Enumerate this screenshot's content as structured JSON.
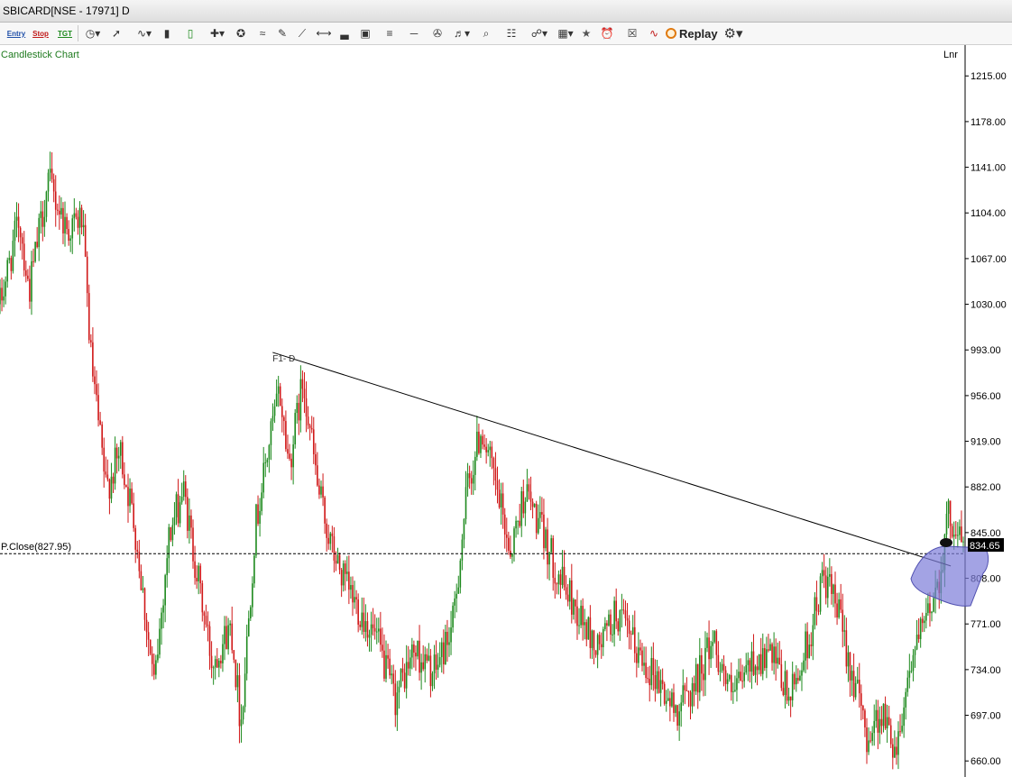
{
  "window": {
    "title": "SBICARD[NSE - 17971] D"
  },
  "toolbar": {
    "entry_label": "Entry",
    "stop_label": "Stop",
    "target_label": "TGT",
    "replay_label": "Replay",
    "icons": [
      "clock-icon",
      "cursor-icon",
      "indicator-icon",
      "bar-chart-icon",
      "candle-icon",
      "crosshair-icon",
      "magnet-icon",
      "wave-icon",
      "ruler-icon",
      "trendline-icon",
      "horizontal-ray-icon",
      "volume-icon",
      "cube-icon",
      "fibonacci-icon",
      "hline-icon",
      "measure-icon",
      "paint-icon",
      "zoom-icon",
      "report-icon",
      "link-icon",
      "layout-icon",
      "star-icon",
      "alert-icon",
      "delete-icon",
      "compare-icon",
      "gear-icon"
    ]
  },
  "chart_header": {
    "label": "Candlestick Chart",
    "scale_label": "Lnr"
  },
  "chart_data": {
    "type": "candlestick",
    "symbol": "SBICARD",
    "yticks": [
      "1215.00",
      "1178.00",
      "1141.00",
      "1104.00",
      "1067.00",
      "1030.00",
      "993.00",
      "956.00",
      "919.00",
      "882.00",
      "845.00",
      "808.00",
      "771.00",
      "734.00",
      "697.00",
      "660.00"
    ],
    "ylim": [
      647,
      1240
    ],
    "prev_close": {
      "label": "P.Close(827.95)",
      "value": 827.95
    },
    "last_price": {
      "label": "834.65",
      "value": 834.65
    },
    "trendline": {
      "label": "F1- D",
      "from_index": 0.283,
      "from_price": 991,
      "to_index": 0.987,
      "to_price": 818
    },
    "up_color": "#1e8a1e",
    "down_color": "#d01818",
    "price_path": [
      [
        0,
        1030
      ],
      [
        0.02,
        1100
      ],
      [
        0.03,
        1040
      ],
      [
        0.05,
        1130
      ],
      [
        0.07,
        1090
      ],
      [
        0.085,
        1100
      ],
      [
        0.095,
        980
      ],
      [
        0.11,
        880
      ],
      [
        0.125,
        910
      ],
      [
        0.14,
        850
      ],
      [
        0.16,
        720
      ],
      [
        0.175,
        840
      ],
      [
        0.19,
        880
      ],
      [
        0.205,
        810
      ],
      [
        0.22,
        740
      ],
      [
        0.24,
        770
      ],
      [
        0.25,
        690
      ],
      [
        0.265,
        850
      ],
      [
        0.28,
        920
      ],
      [
        0.29,
        960
      ],
      [
        0.3,
        900
      ],
      [
        0.315,
        970
      ],
      [
        0.33,
        880
      ],
      [
        0.345,
        830
      ],
      [
        0.36,
        800
      ],
      [
        0.375,
        780
      ],
      [
        0.39,
        760
      ],
      [
        0.41,
        710
      ],
      [
        0.43,
        750
      ],
      [
        0.45,
        730
      ],
      [
        0.47,
        770
      ],
      [
        0.485,
        880
      ],
      [
        0.5,
        930
      ],
      [
        0.515,
        880
      ],
      [
        0.53,
        830
      ],
      [
        0.545,
        880
      ],
      [
        0.56,
        850
      ],
      [
        0.58,
        810
      ],
      [
        0.6,
        780
      ],
      [
        0.62,
        750
      ],
      [
        0.64,
        780
      ],
      [
        0.66,
        750
      ],
      [
        0.68,
        730
      ],
      [
        0.7,
        700
      ],
      [
        0.72,
        720
      ],
      [
        0.74,
        760
      ],
      [
        0.76,
        710
      ],
      [
        0.78,
        740
      ],
      [
        0.8,
        745
      ],
      [
        0.82,
        710
      ],
      [
        0.84,
        760
      ],
      [
        0.855,
        810
      ],
      [
        0.87,
        780
      ],
      [
        0.885,
        730
      ],
      [
        0.9,
        680
      ],
      [
        0.915,
        700
      ],
      [
        0.93,
        670
      ],
      [
        0.945,
        740
      ],
      [
        0.96,
        770
      ],
      [
        0.975,
        810
      ],
      [
        0.985,
        860
      ],
      [
        1.0,
        835
      ]
    ]
  }
}
